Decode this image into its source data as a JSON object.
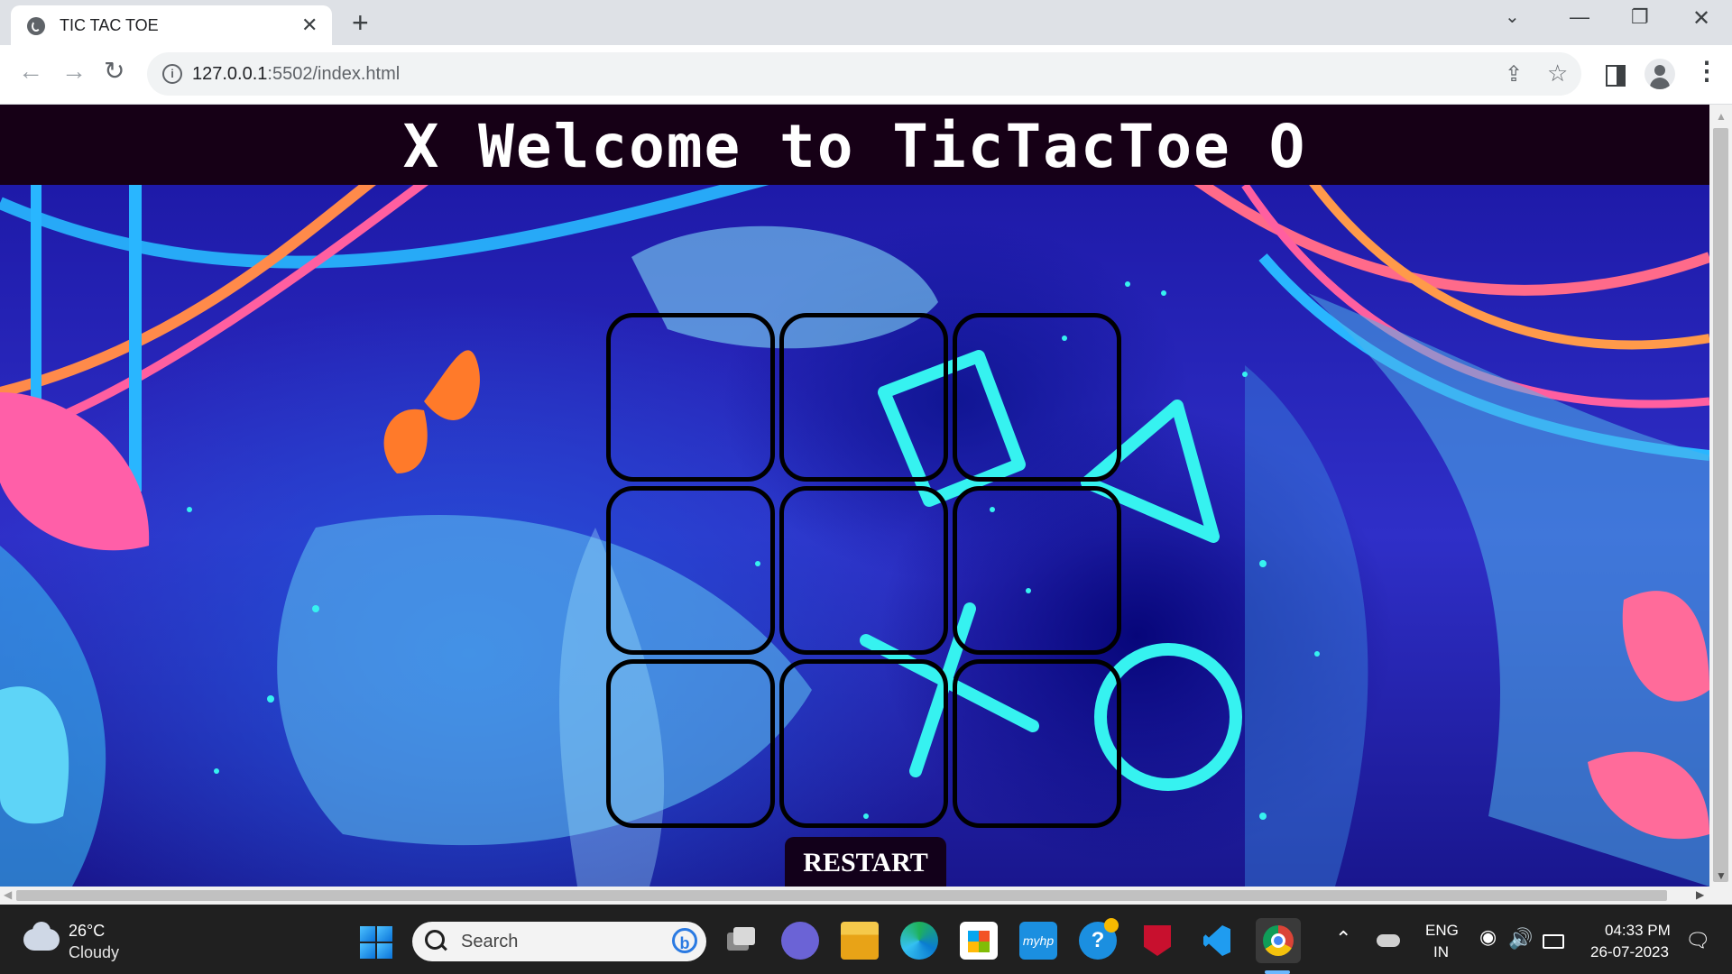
{
  "browser": {
    "tab_title": "TIC TAC TOE",
    "tab_close": "✕",
    "new_tab": "+",
    "url_host": "127.0.0.1",
    "url_path": ":5502/index.html",
    "window_controls": {
      "dropdown": "⌄",
      "minimize": "—",
      "maximize": "❐",
      "close": "✕"
    },
    "nav": {
      "back": "←",
      "forward": "→",
      "reload": "↻"
    },
    "icons": {
      "share": "⇪",
      "star": "☆",
      "menu": "⋮",
      "info": "i"
    }
  },
  "page": {
    "title": "X Welcome to TicTacToe O",
    "board": [
      "",
      "",
      "",
      "",
      "",
      "",
      "",
      "",
      ""
    ],
    "restart_label": "RESTART"
  },
  "taskbar": {
    "weather_temp": "26°C",
    "weather_desc": "Cloudy",
    "search_placeholder": "Search",
    "myhp_label": "myhp",
    "help_label": "?",
    "bing_label": "b",
    "tray_chevron": "⌃",
    "wifi": "◉",
    "volume": "🔊",
    "lang_line1": "ENG",
    "lang_line2": "IN",
    "time": "04:33 PM",
    "date": "26-07-2023",
    "notifications": "🗨"
  },
  "colors": {
    "header_bg": "#160016",
    "background_main": "#2f2fc8",
    "neon_cyan": "#36f2f0",
    "restart_bg": "#12001a"
  }
}
